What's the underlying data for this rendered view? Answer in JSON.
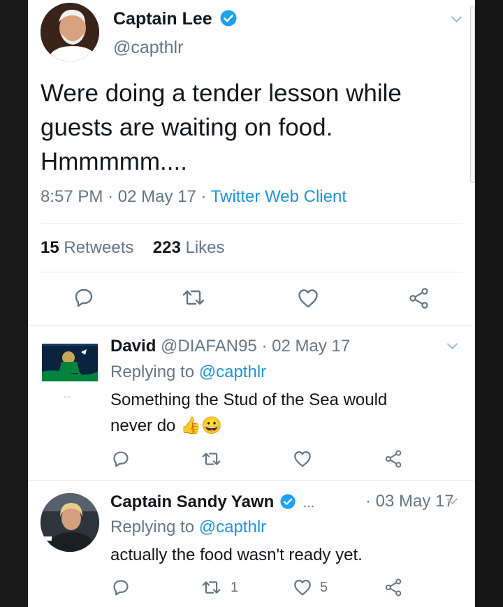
{
  "main_tweet": {
    "author_name": "Captain Lee",
    "handle": "@capthlr",
    "text_line1": "Were doing a tender lesson while",
    "text_line2": "guests are waiting on food.",
    "text_line3": "Hmmmmm....",
    "time": "8:57 PM",
    "sep1": "·",
    "date": "02 May 17",
    "sep2": "·",
    "source": "Twitter Web Client",
    "retweet_count": "15",
    "retweet_label": "Retweets",
    "like_count": "223",
    "like_label": "Likes"
  },
  "replies": [
    {
      "author_name": "David",
      "handle": "@DIAFAN95",
      "sep": "·",
      "date": "02 May 17",
      "replying_label": "Replying to",
      "replying_to": "@capthlr",
      "text_line1": "Something the Stud of the Sea would",
      "text_line2": "never do",
      "emoji_text": "👍😀",
      "retweet_count": "",
      "like_count": ""
    },
    {
      "author_name": "Captain Sandy Yawn",
      "ellipsis": "...",
      "sep": "·",
      "date": "03 May 17",
      "replying_label": "Replying to",
      "replying_to": "@capthlr",
      "text_line1": "actually the food wasn't ready yet.",
      "retweet_count": "1",
      "like_count": "5"
    }
  ],
  "colors": {
    "text": "#14171a",
    "secondary": "#657786",
    "link": "#1b95e0",
    "verified": "#1da1f2",
    "icon": "#657786"
  },
  "icons": [
    "verified-badge-icon",
    "chevron-down-icon",
    "reply-icon",
    "retweet-icon",
    "heart-icon",
    "share-icon"
  ]
}
